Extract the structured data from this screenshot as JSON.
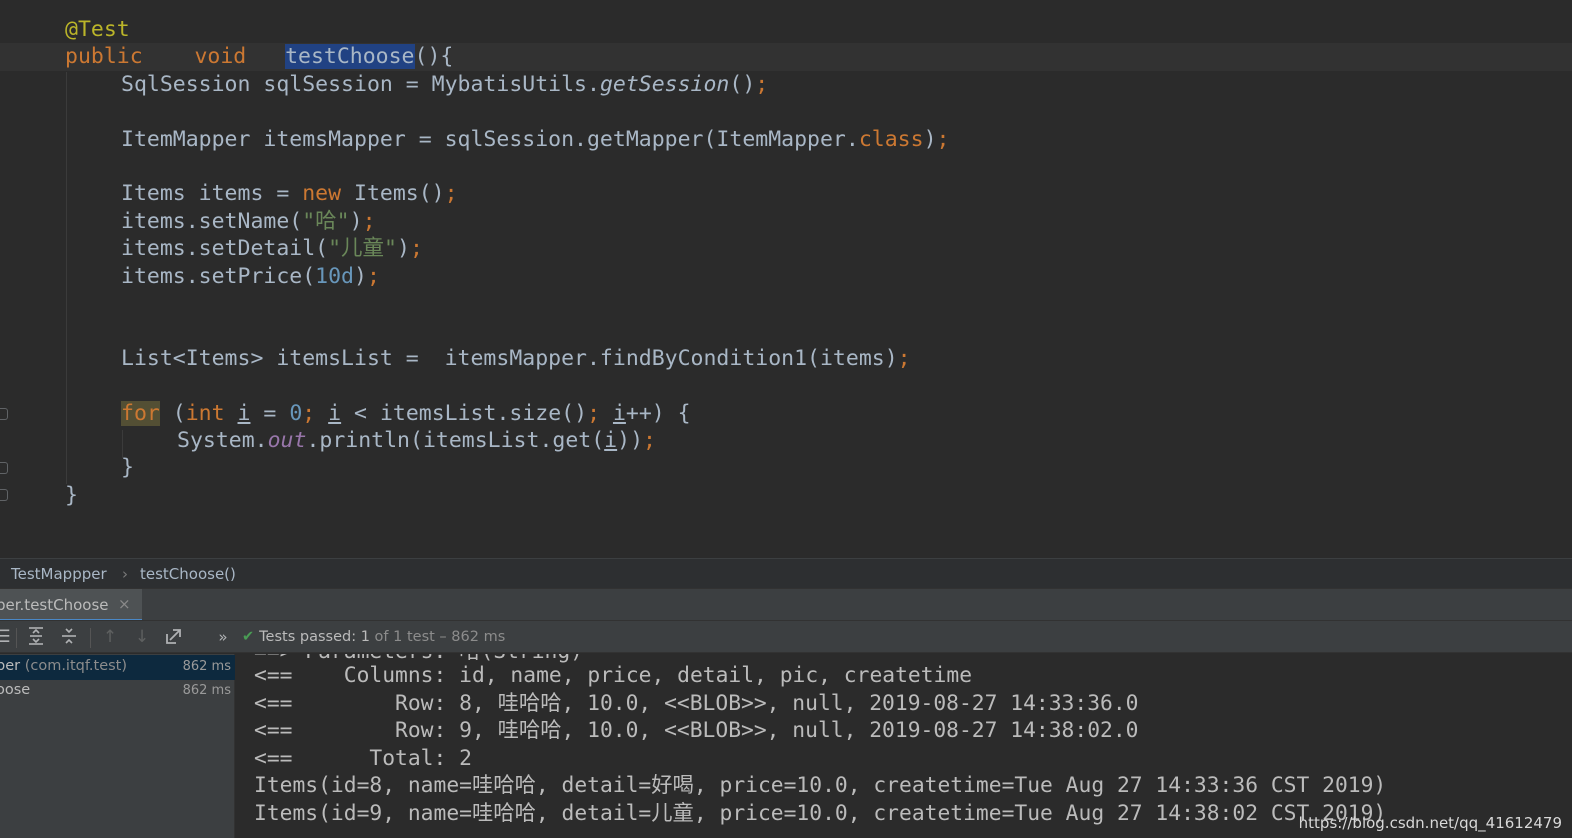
{
  "editor": {
    "lines": [
      {
        "html": "<span class=\"ann\">@Test</span>",
        "indent": 0
      },
      {
        "html": "<span class=\"kw\">public    void   </span><span class=\"sel\">testChoose</span>(){",
        "indent": 0
      },
      {
        "html": "SqlSession sqlSession = MybatisUtils.<span class=\"it\">getSession</span>()<span class=\"kw\">;</span>",
        "indent": 1
      },
      {
        "html": "",
        "indent": 1
      },
      {
        "html": "ItemMapper itemsMapper = sqlSession.getMapper(ItemMapper.<span class=\"kw\">class</span>)<span class=\"kw\">;</span>",
        "indent": 1
      },
      {
        "html": "",
        "indent": 1
      },
      {
        "html": "Items items = <span class=\"kw\">new </span>Items()<span class=\"kw\">;</span>",
        "indent": 1
      },
      {
        "html": "items.setName(<span class=\"str\">\"哈\"</span>)<span class=\"kw\">;</span>",
        "indent": 1
      },
      {
        "html": "items.setDetail(<span class=\"str\">\"儿童\"</span>)<span class=\"kw\">;</span>",
        "indent": 1
      },
      {
        "html": "items.setPrice(<span class=\"num\">10d</span>)<span class=\"kw\">;</span>",
        "indent": 1
      },
      {
        "html": "",
        "indent": 1
      },
      {
        "html": "",
        "indent": 1
      },
      {
        "html": "List&lt;Items&gt; itemsList =  itemsMapper.findByCondition1(items)<span class=\"kw\">;</span>",
        "indent": 1
      },
      {
        "html": "",
        "indent": 1
      },
      {
        "html": "<span class=\"kw forhl\">for</span> (<span class=\"kw\">int </span><span class=\"ul\">i</span> = <span class=\"num\">0</span><span class=\"kw\">; </span><span class=\"ul\">i</span> &lt; itemsList.size()<span class=\"kw\">; </span><span class=\"ul\">i</span>++) {",
        "indent": 1
      },
      {
        "html": "System.<span class=\"fld\">out</span>.println(itemsList.get(<span class=\"ul\">i</span>))<span class=\"kw\">;</span>",
        "indent": 2
      },
      {
        "html": "}",
        "indent": 1
      },
      {
        "html": "}",
        "indent": 0
      }
    ]
  },
  "breadcrumb": {
    "class_name": "TestMappper",
    "separator": "›",
    "method_name": "testChoose()"
  },
  "run_tab": {
    "label": "per.testChoose",
    "close": "×"
  },
  "toolbar": {
    "icons": [
      "list-icon",
      "expand-all-icon",
      "collapse-all-icon",
      "arrow-up-icon",
      "arrow-down-icon",
      "export-icon",
      "more-icon"
    ],
    "more": "»",
    "status_check": "✔",
    "status_prefix": "Tests passed: ",
    "status_count": "1",
    "status_suffix": " of 1 test – 862 ms"
  },
  "tree": {
    "rows": [
      {
        "name": "per",
        "package": " (com.itqf.test)",
        "time": "862 ms",
        "selected": true
      },
      {
        "name": "oose",
        "package": "",
        "time": "862 ms",
        "selected": false
      }
    ]
  },
  "console": {
    "partial_top": "==> Parameters: 哈(String)",
    "lines": [
      "<==    Columns: id, name, price, detail, pic, createtime",
      "<==        Row: 8, 哇哈哈, 10.0, <<BLOB>>, null, 2019-08-27 14:33:36.0",
      "<==        Row: 9, 哇哈哈, 10.0, <<BLOB>>, null, 2019-08-27 14:38:02.0",
      "<==      Total: 2",
      "Items(id=8, name=哇哈哈, detail=好喝, price=10.0, createtime=Tue Aug 27 14:33:36 CST 2019)",
      "Items(id=9, name=哇哈哈, detail=儿童, price=10.0, createtime=Tue Aug 27 14:38:02 CST 2019)"
    ],
    "watermark": "https://blog.csdn.net/qq_41612479"
  }
}
